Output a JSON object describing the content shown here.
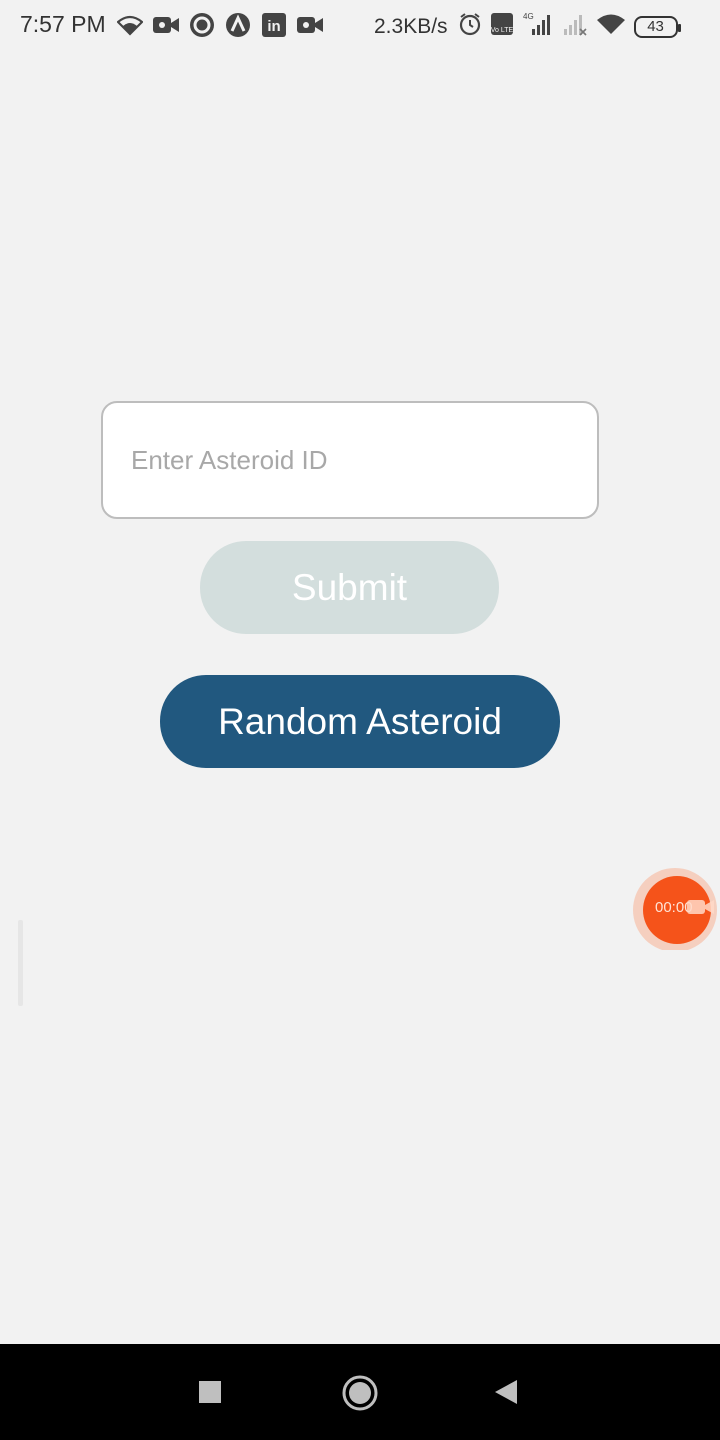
{
  "status_bar": {
    "time": "7:57 PM",
    "net_speed": "2.3KB/s",
    "battery": "43",
    "left_icons": [
      "wifi-icon",
      "video-camera-icon",
      "circle-app-icon",
      "arrow-app-icon",
      "linkedin-icon",
      "video-camera-icon"
    ],
    "right_icons": [
      "alarm-icon",
      "volte-icon",
      "signal-4g-icon",
      "signal-icon",
      "wifi-icon",
      "battery-icon"
    ],
    "linkedin_glyph": "in",
    "volte_glyph": "Vo LTE",
    "network_type": "4G"
  },
  "form": {
    "asteroid_input_placeholder": "Enter Asteroid ID",
    "asteroid_input_value": "",
    "submit_label": "Submit",
    "random_label": "Random Asteroid"
  },
  "recorder": {
    "timer": "00:00"
  },
  "colors": {
    "background": "#f2f2f2",
    "submit_disabled_bg": "#d3dedd",
    "random_button_bg": "#21587f",
    "recorder_orange": "#f5531a"
  },
  "nav": {
    "icons": [
      "recents-square-icon",
      "home-circle-icon",
      "back-triangle-icon"
    ]
  }
}
